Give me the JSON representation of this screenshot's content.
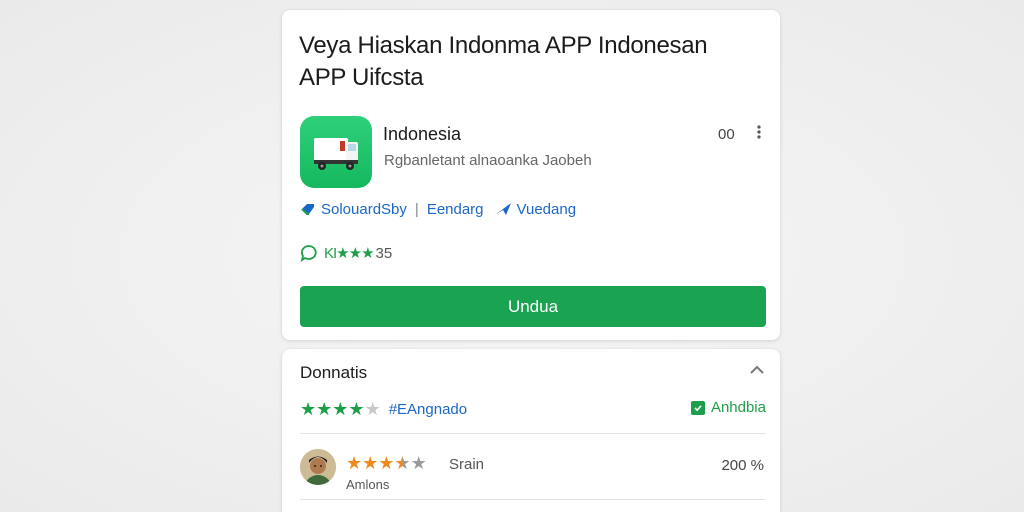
{
  "app_card": {
    "title": "Veya Hiaskan Indonma APP Indonesan APP Uifcsta",
    "app_name": "Indonesia",
    "app_subtitle": "Rgbanletant alnaoanka Jaobeh",
    "count": "00",
    "links": {
      "link1": "SolouardSby",
      "separator": "|",
      "link2": "Eendarg",
      "link3": "Vuedang"
    },
    "rating_text": "KI★★★",
    "rating_count": "35",
    "install_label": "Undua"
  },
  "details_card": {
    "title": "Donnatis",
    "summary_stars_filled": 4,
    "summary_stars_total": 5,
    "tag": "#EAngnado",
    "badge_label": "Anhdbia",
    "review": {
      "stars_filled": 3.5,
      "stars_total": 5,
      "reviewer": "Srain",
      "name": "Amlons",
      "percent": "200 %"
    }
  },
  "colors": {
    "accent_green": "#1aa350",
    "link_blue": "#1b66c9",
    "review_orange": "#f08a1c"
  },
  "icons": {
    "more": "more-vert-icon",
    "chevron": "chevron-up-icon",
    "link1": "tag-icon",
    "link3": "send-icon",
    "rating": "chat-bubble-icon",
    "badge": "check-box-icon"
  }
}
